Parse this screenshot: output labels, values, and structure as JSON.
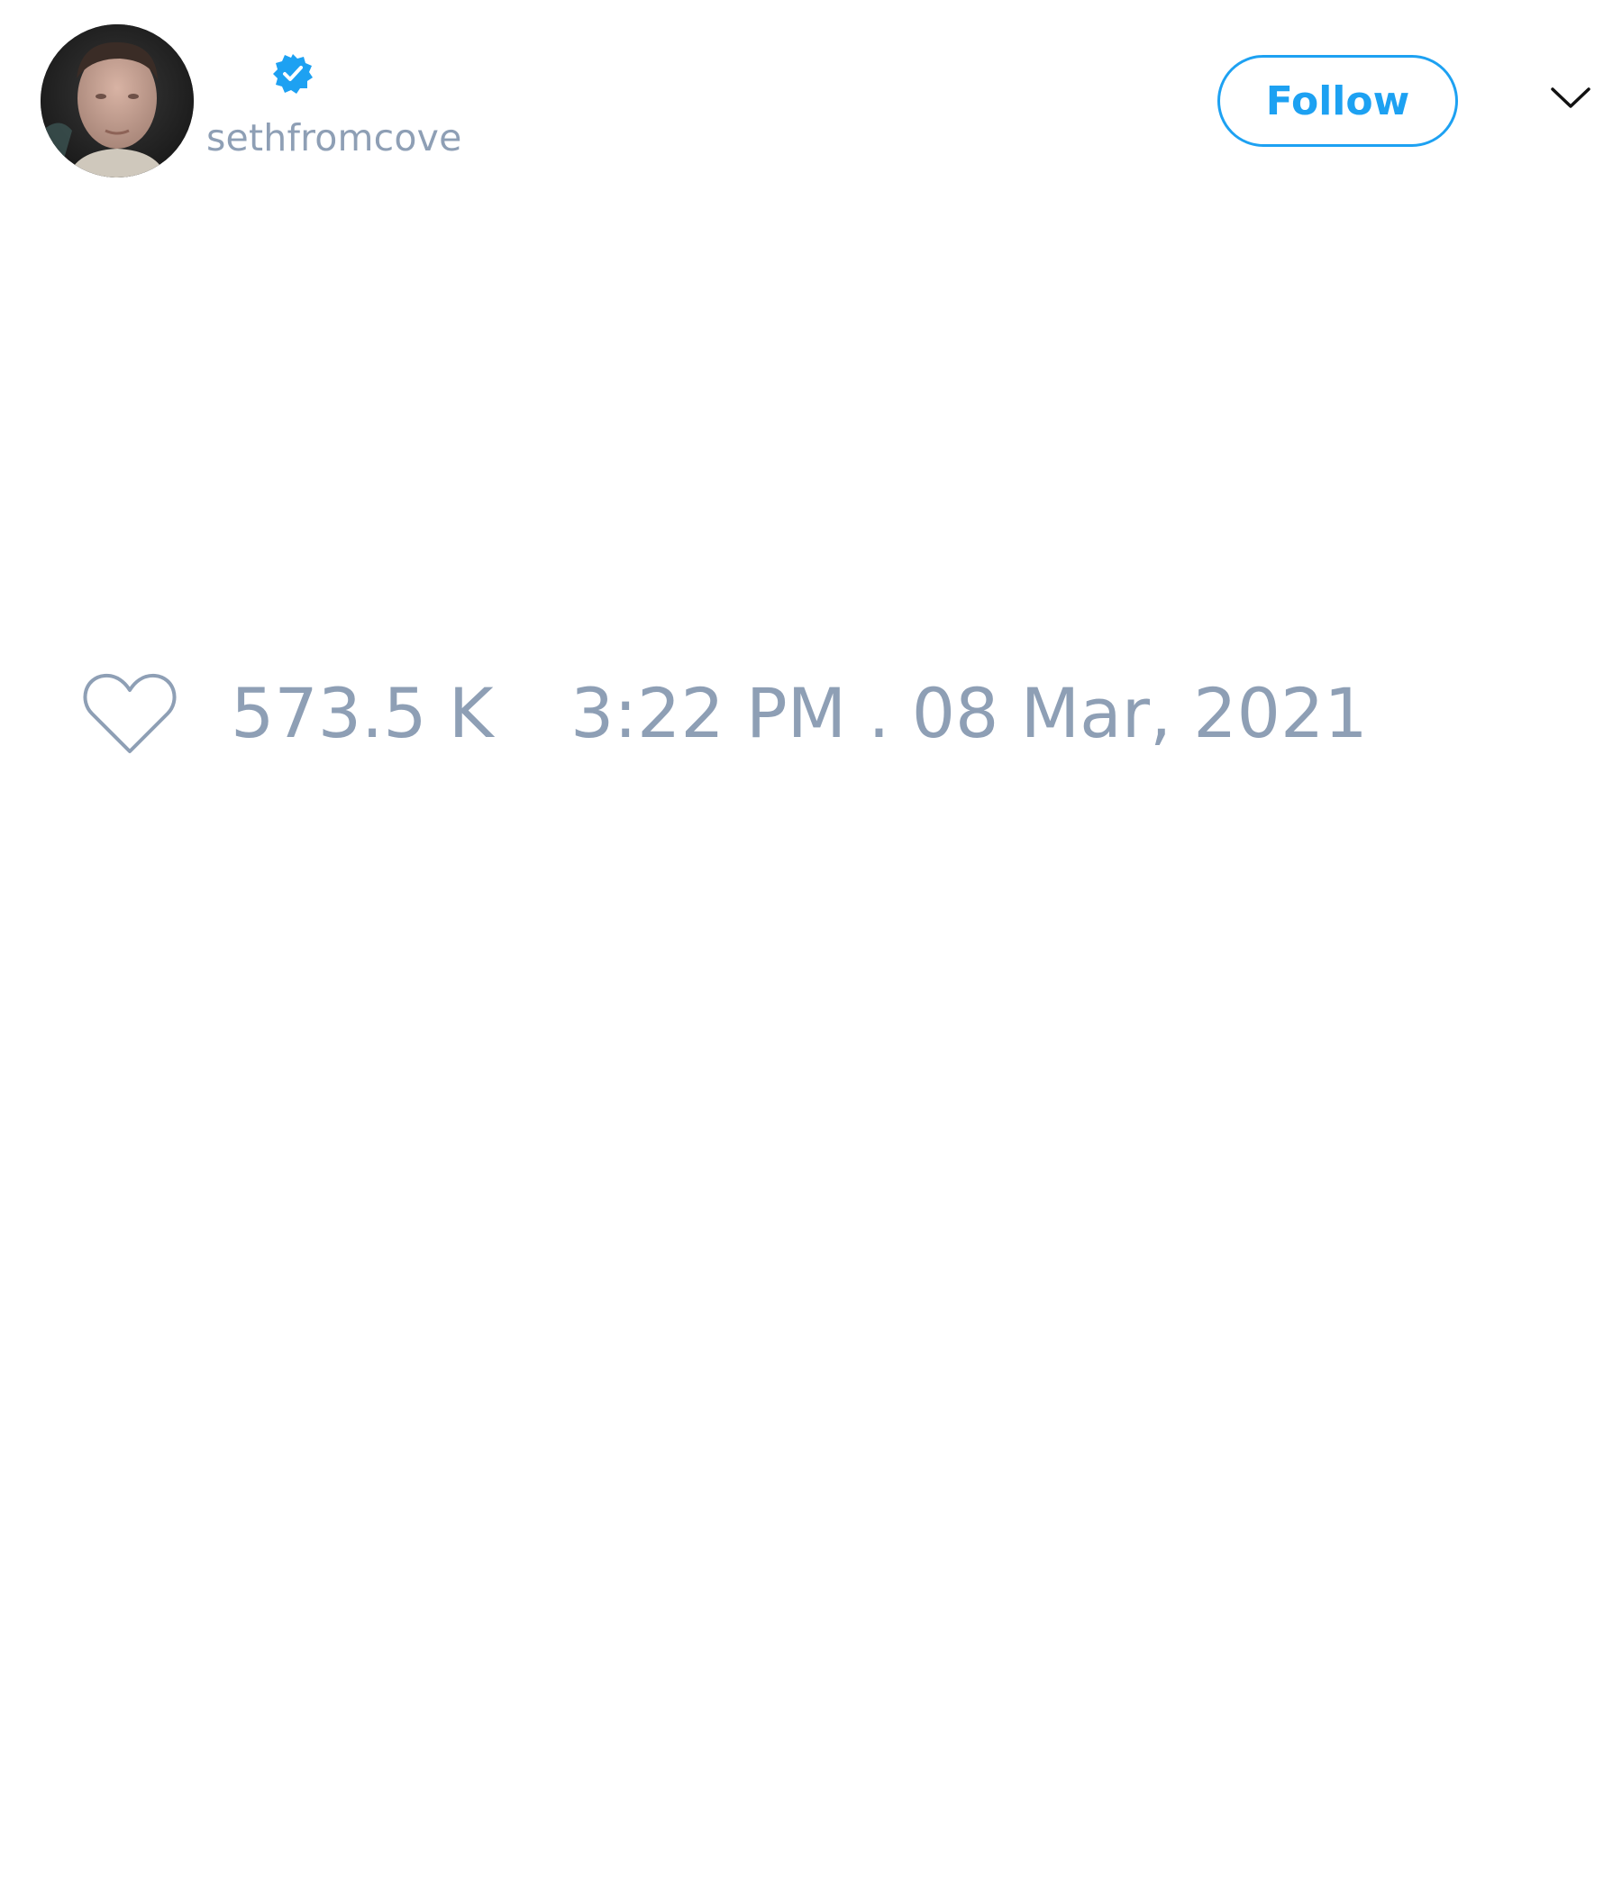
{
  "tweet": {
    "author": {
      "handle": "sethfromcove",
      "verified": true,
      "avatar_icon": "person-photo-avatar"
    },
    "follow_label": "Follow",
    "menu_icon": "chevron-down-icon",
    "likes": "573.5 K",
    "timestamp": "3:22 PM . 08 Mar, 2021",
    "heart_icon": "heart-outline-icon"
  },
  "colors": {
    "accent": "#1da1f2",
    "muted_text": "#8e9fb5",
    "background": "#ffffff"
  }
}
